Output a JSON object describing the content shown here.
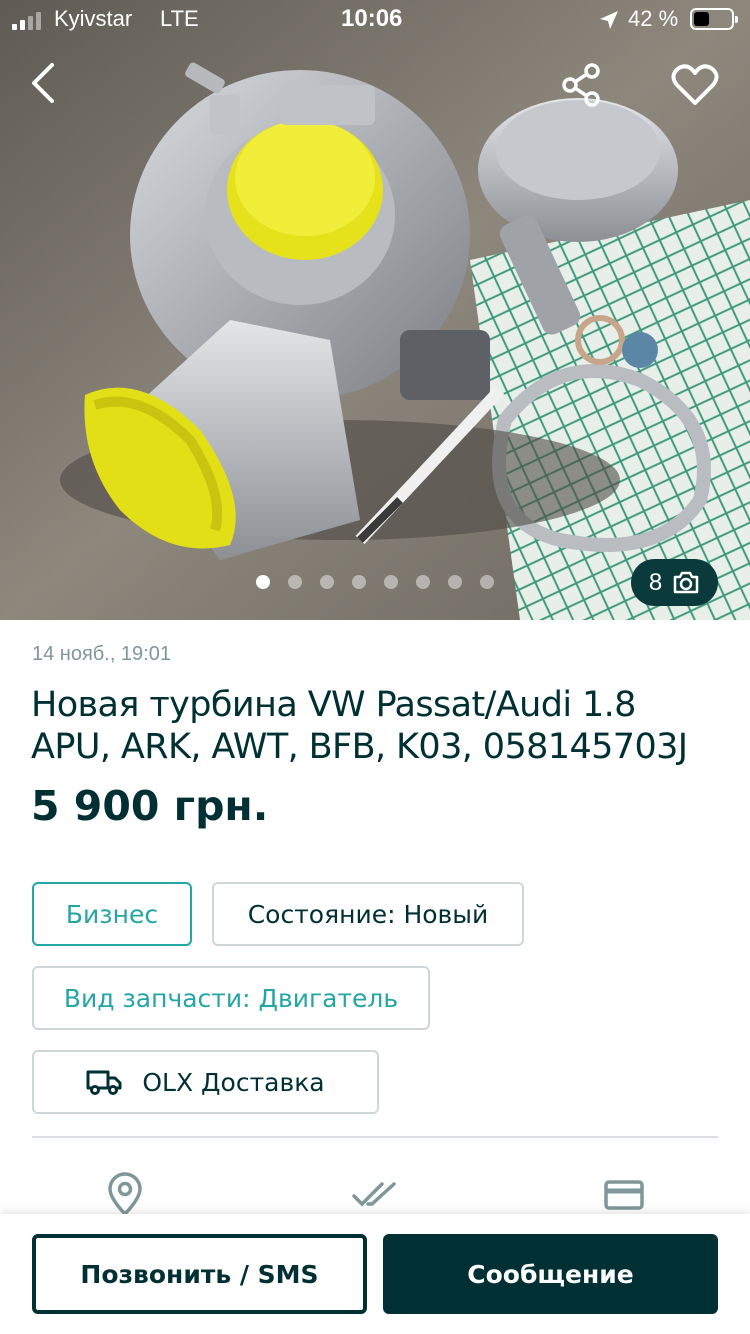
{
  "status_bar": {
    "carrier": "Kyivstar",
    "network": "LTE",
    "time": "10:06",
    "battery_percent": "42 %",
    "battery_level": 0.42
  },
  "gallery": {
    "photo_count": "8",
    "total_dots": 8,
    "active_index": 0
  },
  "icons": {
    "back": "back-arrow-icon",
    "share": "share-icon",
    "favorite": "heart-icon",
    "camera": "camera-icon",
    "truck": "truck-icon",
    "location": "location-pin-icon",
    "check": "double-check-icon",
    "card": "credit-card-icon"
  },
  "listing": {
    "date": "14 нояб., 19:01",
    "title": "Новая турбина VW Passat/Audi 1.8 APU, ARK, AWT, BFB, K03, 058145703J",
    "price": "5 900 грн.",
    "tags": {
      "business": "Бизнес",
      "condition": "Состояние: Новый",
      "part_type": "Вид запчасти: Двигатель",
      "delivery": "OLX Доставка"
    }
  },
  "actions": {
    "call": "Позвонить / SMS",
    "message": "Сообщение"
  },
  "colors": {
    "primary": "#002f34",
    "accent": "#23a6a4",
    "border": "#cfd6d8",
    "muted_text": "#7f9799",
    "badge_bg": "#0b3a3c"
  }
}
